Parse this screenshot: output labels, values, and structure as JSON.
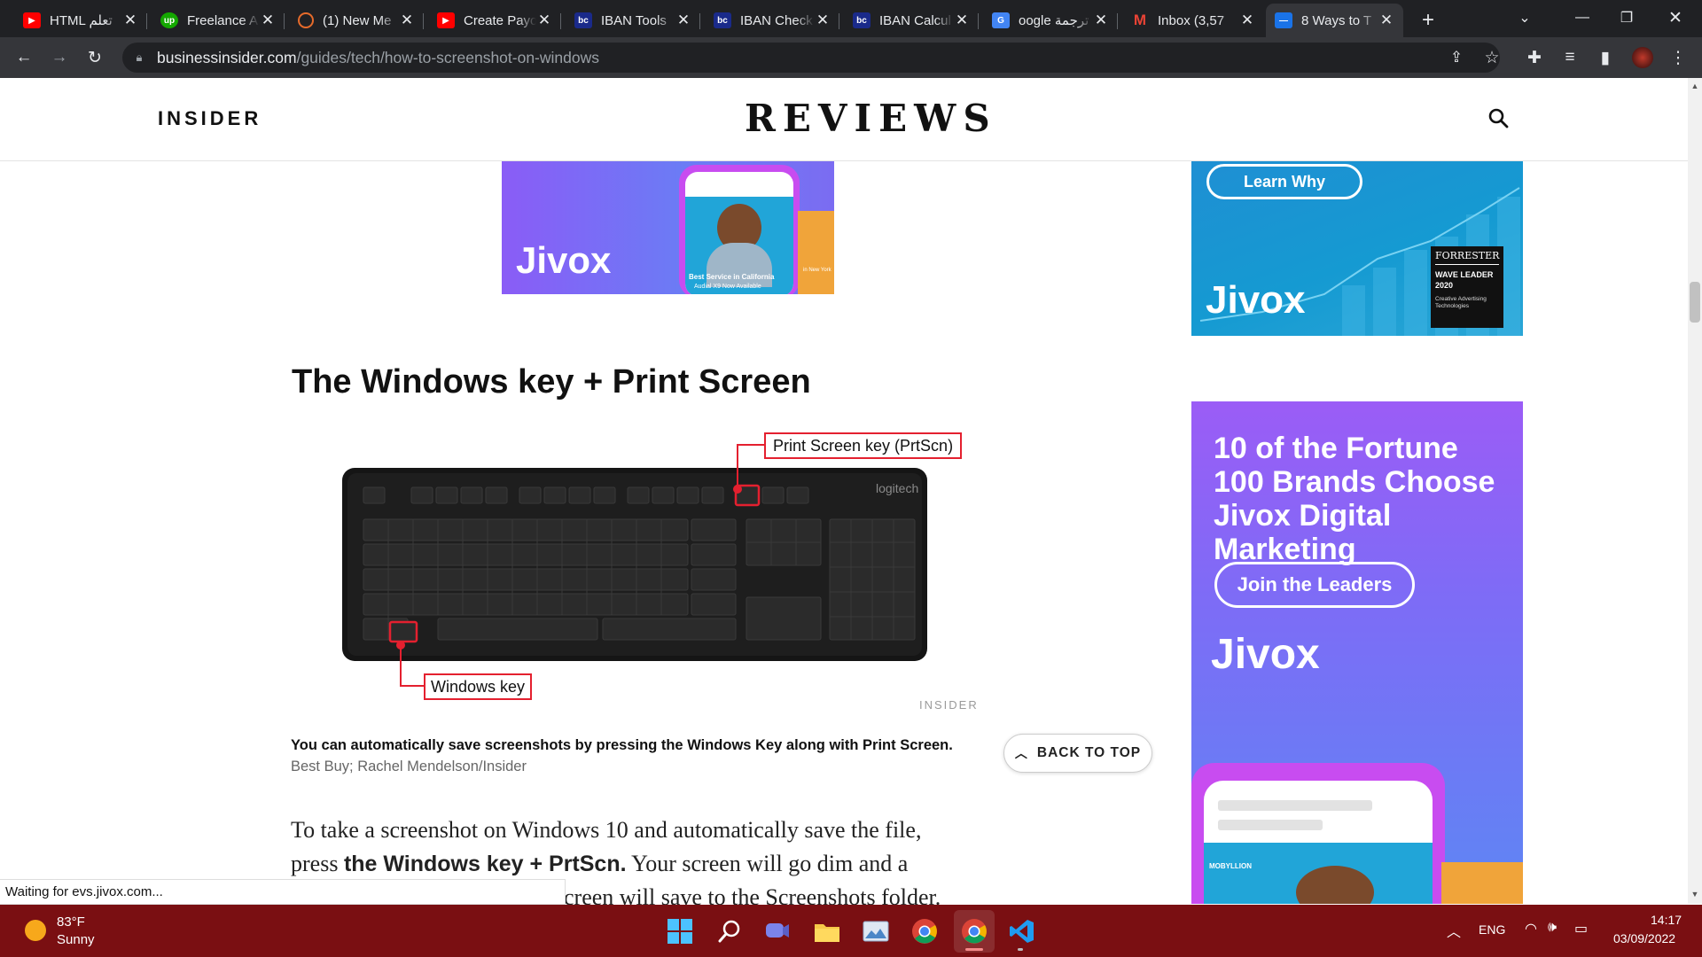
{
  "tabs": [
    {
      "title": "HTML تعلم",
      "icon": "youtube-icon"
    },
    {
      "title": "Freelance A",
      "icon": "upwork-icon"
    },
    {
      "title": "(1) New Me",
      "icon": "circle-logo-icon"
    },
    {
      "title": "Create Payo",
      "icon": "youtube-icon"
    },
    {
      "title": "IBAN Tools",
      "icon": "bc-icon"
    },
    {
      "title": "IBAN Check",
      "icon": "bc-icon"
    },
    {
      "title": "IBAN Calcul",
      "icon": "bc-icon"
    },
    {
      "title": "oogle ترجمة",
      "icon": "google-translate-icon"
    },
    {
      "title": "Inbox (3,57",
      "icon": "gmail-icon"
    },
    {
      "title": "8 Ways to T",
      "icon": "business-insider-icon",
      "active": true
    }
  ],
  "url": {
    "host": "businessinsider.com",
    "path": "/guides/tech/how-to-screenshot-on-windows"
  },
  "site": {
    "left_logo": "INSIDER",
    "center_logo": "REVIEWS"
  },
  "ads": {
    "top_left": {
      "brand": "Jivox",
      "phone_text": "Best Service in California",
      "phone_sub": "Audial X9 Now Available",
      "side_text": "in New York"
    },
    "top_right": {
      "cta": "Learn Why",
      "brand": "Jivox",
      "badge_title": "FORRESTER",
      "badge_sub": "WAVE LEADER 2020",
      "badge_desc": "Creative Advertising Technologies"
    },
    "sidebar": {
      "headline": "10 of the Fortune 100 Brands Choose Jivox Digital Marketing",
      "cta": "Join the Leaders",
      "brand": "Jivox",
      "phone_brand": "MOBYLLION"
    }
  },
  "article": {
    "heading": "The Windows key + Print Screen",
    "callout_prtscn": "Print Screen key (PrtScn)",
    "callout_win": "Windows key",
    "keyboard_brand": "logitech",
    "image_watermark": "INSIDER",
    "caption": "You can automatically save screenshots by pressing the Windows Key along with Print Screen.",
    "credit": "Best Buy; Rachel Mendelson/Insider",
    "back_to_top": "BACK TO TOP",
    "para_1": "To take a screenshot on Windows 10 and automatically save the file,",
    "para_2a": "press ",
    "para_2b": "the Windows key + PrtScn.",
    "para_2c": " Your screen will go dim and a",
    "para_3": "creen will save to the Screenshots folder."
  },
  "status_text": "Waiting for evs.jivox.com...",
  "taskbar": {
    "temp": "83°F",
    "condition": "Sunny",
    "lang": "ENG",
    "time": "14:17",
    "date": "03/09/2022"
  },
  "colors": {
    "tab_bar": "#202124",
    "toolbar": "#35363a",
    "taskbar": "#7a0f12",
    "callout_red": "#e4202f",
    "ad_purple": "#8a5cf6",
    "ad_blue": "#1f8fd3"
  }
}
